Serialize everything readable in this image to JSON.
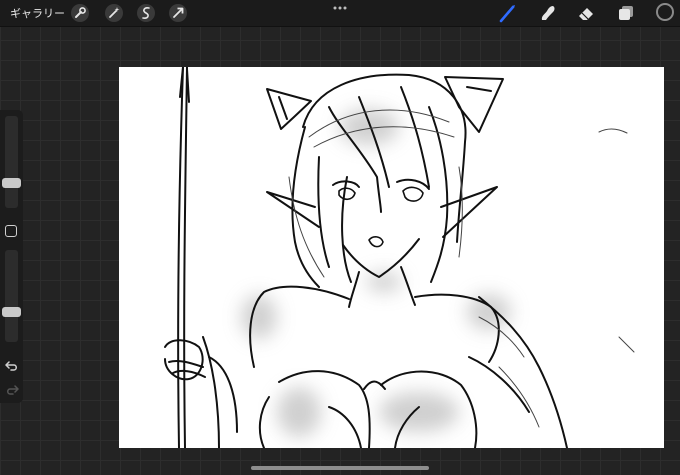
{
  "toolbar": {
    "gallery_label": "ギャラリー",
    "left_tools": [
      "wrench-icon",
      "magic-wand-icon",
      "selection-icon",
      "transform-icon"
    ],
    "right_tools": [
      "brush-icon",
      "smudge-icon",
      "eraser-icon",
      "layers-icon"
    ],
    "active_tool": "brush-icon",
    "accent_color": "#2f6bff",
    "current_color": "#1b1b1b"
  },
  "sidebar": {
    "brush_size_level": 0.25,
    "opacity_level": 0.3
  },
  "canvas": {
    "background": "#ffffff"
  }
}
